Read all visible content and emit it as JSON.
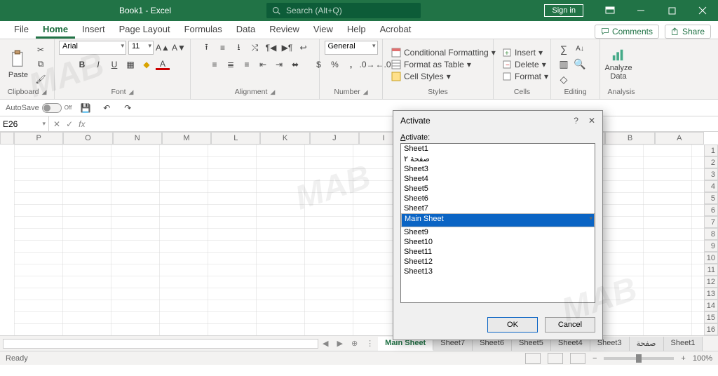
{
  "title": "Book1  -  Excel",
  "search_placeholder": "Search (Alt+Q)",
  "signin": "Sign in",
  "menu": [
    "File",
    "Home",
    "Insert",
    "Page Layout",
    "Formulas",
    "Data",
    "Review",
    "View",
    "Help",
    "Acrobat"
  ],
  "active_menu": 1,
  "comments_btn": "Comments",
  "share_btn": "Share",
  "ribbon": {
    "clipboard": {
      "paste": "Paste",
      "label": "Clipboard"
    },
    "font": {
      "name": "Arial",
      "size": "11",
      "label": "Font"
    },
    "alignment": {
      "label": "Alignment"
    },
    "number": {
      "format": "General",
      "label": "Number"
    },
    "styles": {
      "cond": "Conditional Formatting",
      "table": "Format as Table",
      "cell": "Cell Styles",
      "label": "Styles"
    },
    "cells": {
      "insert": "Insert",
      "delete": "Delete",
      "format": "Format",
      "label": "Cells"
    },
    "editing": {
      "label": "Editing"
    },
    "analysis": {
      "btn": "Analyze\nData",
      "label": "Analysis"
    }
  },
  "autosave": "AutoSave",
  "autosave_state": "Off",
  "namebox": "E26",
  "columns": [
    "P",
    "O",
    "N",
    "M",
    "L",
    "K",
    "J",
    "I",
    "H",
    "",
    "",
    "",
    "B",
    "A"
  ],
  "row_count": 16,
  "sheet_tabs": [
    "Main Sheet",
    "Sheet7",
    "Sheet6",
    "Sheet5",
    "Sheet4",
    "Sheet3",
    "صفحة",
    "Sheet1"
  ],
  "active_sheet": 0,
  "status": "Ready",
  "zoom": "100%",
  "dialog": {
    "title": "Activate",
    "label": "Activate:",
    "items": [
      "Sheet1",
      "صفحة ٢",
      "Sheet3",
      "Sheet4",
      "Sheet5",
      "Sheet6",
      "Sheet7",
      "Main Sheet",
      "Sheet9",
      "Sheet10",
      "Sheet11",
      "Sheet12",
      "Sheet13"
    ],
    "selected": 7,
    "ok": "OK",
    "cancel": "Cancel"
  }
}
